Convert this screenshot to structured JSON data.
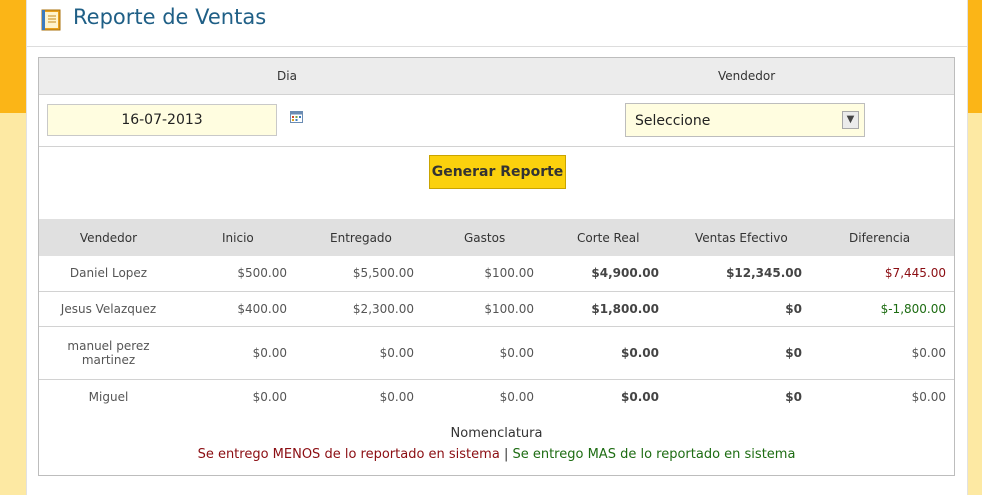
{
  "page": {
    "title": "Reporte de Ventas"
  },
  "filters": {
    "dia_label": "Dia",
    "vendedor_label": "Vendedor",
    "date_value": "16-07-2013",
    "vendedor_selected": "Seleccione"
  },
  "actions": {
    "generate_label": "Generar Reporte"
  },
  "table": {
    "headers": [
      "Vendedor",
      "Inicio",
      "Entregado",
      "Gastos",
      "Corte Real",
      "Ventas Efectivo",
      "Diferencia"
    ],
    "rows": [
      {
        "vendedor": "Daniel Lopez",
        "inicio": "$500.00",
        "entregado": "$5,500.00",
        "gastos": "$100.00",
        "corte_real": "$4,900.00",
        "ventas_efectivo": "$12,345.00",
        "diferencia": "$7,445.00"
      },
      {
        "vendedor": "Jesus Velazquez",
        "inicio": "$400.00",
        "entregado": "$2,300.00",
        "gastos": "$100.00",
        "corte_real": "$1,800.00",
        "ventas_efectivo": "$0",
        "diferencia": "$-1,800.00"
      },
      {
        "vendedor": "manuel perez martinez",
        "inicio": "$0.00",
        "entregado": "$0.00",
        "gastos": "$0.00",
        "corte_real": "$0.00",
        "ventas_efectivo": "$0",
        "diferencia": "$0.00"
      },
      {
        "vendedor": "Miguel",
        "inicio": "$0.00",
        "entregado": "$0.00",
        "gastos": "$0.00",
        "corte_real": "$0.00",
        "ventas_efectivo": "$0",
        "diferencia": "$0.00"
      }
    ]
  },
  "legend": {
    "title": "Nomenclatura",
    "menos_text": "Se entrego MENOS de lo reportado en sistema",
    "separator": "|",
    "mas_text": "Se entrego MAS de lo reportado en sistema"
  },
  "colors": {
    "accent_band": "#fbb517",
    "background": "#fde9a3",
    "title": "#1f5f86",
    "button": "#fbd10d",
    "negative_red": "#8b0d12",
    "positive_green": "#1d6c12"
  },
  "icons": {
    "title_icon": "notebook-icon",
    "calendar_icon": "calendar-icon",
    "select_arrow": "chevron-down-icon"
  }
}
